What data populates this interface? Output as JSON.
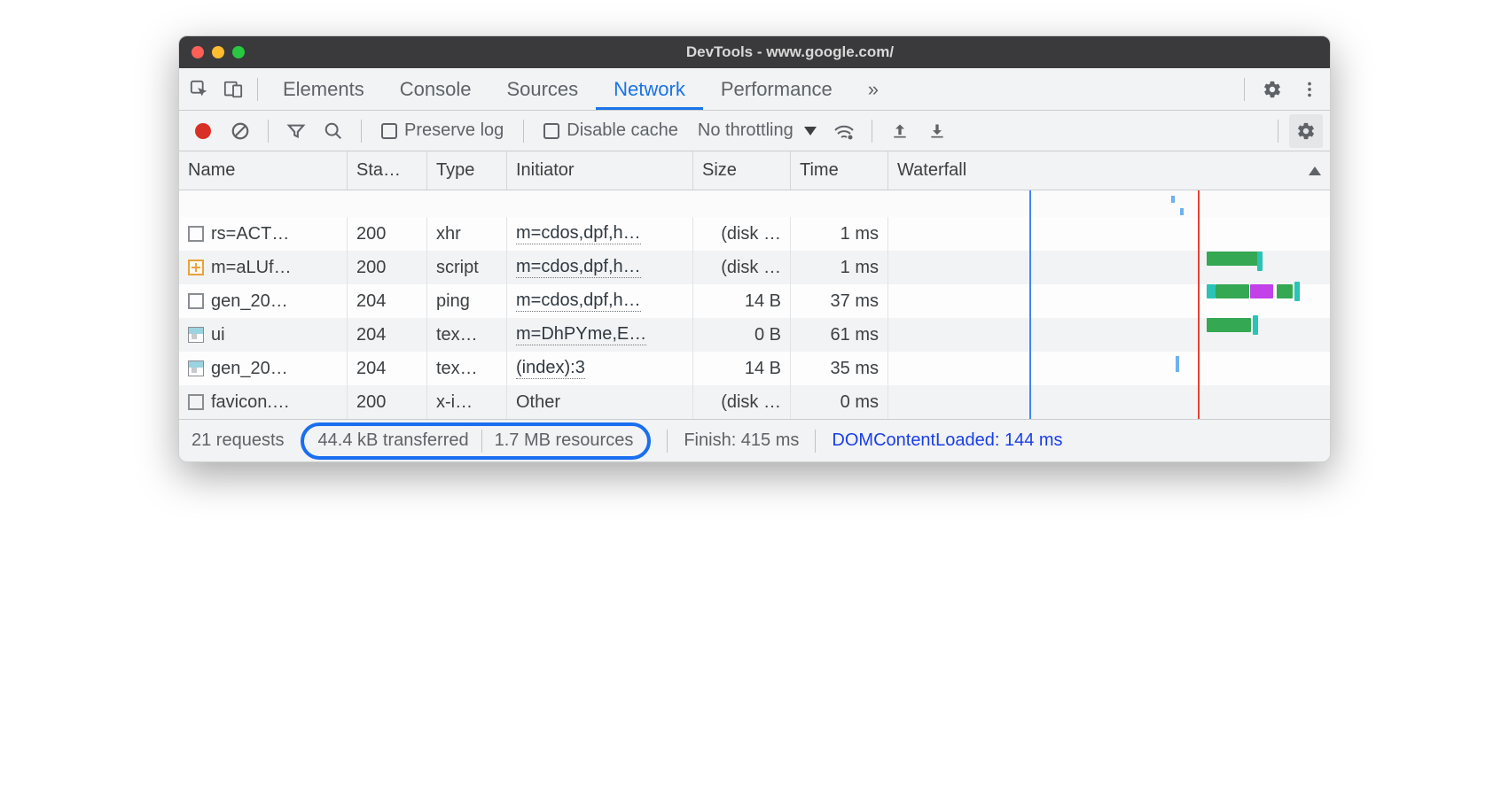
{
  "titlebar": {
    "title": "DevTools - www.google.com/"
  },
  "tabs": {
    "items": [
      "Elements",
      "Console",
      "Sources",
      "Network",
      "Performance"
    ],
    "overflow": "»",
    "active": "Network"
  },
  "toolbar": {
    "preserve_log": "Preserve log",
    "disable_cache": "Disable cache",
    "throttling": "No throttling"
  },
  "columns": [
    "Name",
    "Sta…",
    "Type",
    "Initiator",
    "Size",
    "Time",
    "Waterfall"
  ],
  "rows": [
    {
      "icon": "doc",
      "name": "rs=ACT…",
      "status": "200",
      "type": "xhr",
      "initiator": "m=cdos,dpf,h…",
      "initiator_link": true,
      "size": "(disk …",
      "time": "1 ms"
    },
    {
      "icon": "script",
      "name": "m=aLUf…",
      "status": "200",
      "type": "script",
      "initiator": "m=cdos,dpf,h…",
      "initiator_link": true,
      "size": "(disk …",
      "time": "1 ms"
    },
    {
      "icon": "doc",
      "name": "gen_20…",
      "status": "204",
      "type": "ping",
      "initiator": "m=cdos,dpf,h…",
      "initiator_link": true,
      "size": "14 B",
      "time": "37 ms"
    },
    {
      "icon": "img",
      "name": "ui",
      "status": "204",
      "type": "tex…",
      "initiator": "m=DhPYme,E…",
      "initiator_link": true,
      "size": "0 B",
      "time": "61 ms"
    },
    {
      "icon": "img",
      "name": "gen_20…",
      "status": "204",
      "type": "tex…",
      "initiator": "(index):3",
      "initiator_link": true,
      "size": "14 B",
      "time": "35 ms"
    },
    {
      "icon": "doc",
      "name": "favicon.…",
      "status": "200",
      "type": "x-i…",
      "initiator": "Other",
      "initiator_link": false,
      "size": "(disk …",
      "time": "0 ms"
    }
  ],
  "status": {
    "requests": "21 requests",
    "transferred": "44.4 kB transferred",
    "resources": "1.7 MB resources",
    "finish": "Finish: 415 ms",
    "dcl": "DOMContentLoaded: 144 ms"
  }
}
